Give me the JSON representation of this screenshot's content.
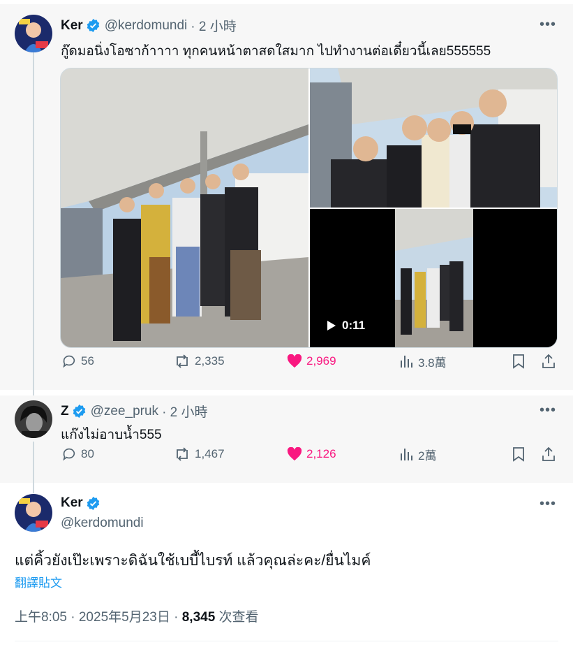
{
  "tweet1": {
    "name": "Ker",
    "handle": "@kerdomundi",
    "time": "· 2 小時",
    "text": "กู๊ดมอนิ่งโอซาก้าาาา ทุกคนหน้าตาสดใสมาก ไปทำงานต่อเดี๋ยวนี้เลย555555",
    "video_duration": "0:11",
    "replies": "56",
    "retweets": "2,335",
    "likes": "2,969",
    "views": "3.8萬"
  },
  "tweet2": {
    "name": "Z",
    "handle": "@zee_pruk",
    "time": "· 2 小時",
    "text": "แก๊งไม่อาบน้ำ555",
    "replies": "80",
    "retweets": "1,467",
    "likes": "2,126",
    "views": "2萬"
  },
  "tweet3": {
    "name": "Ker",
    "handle": "@kerdomundi",
    "text": "แต่คิ้วยังเป๊ะเพราะดิฉันใช้เบบี้ไบรท์ แล้วคุณล่ะคะ/ยื่นไมค์",
    "translate": "翻譯貼文",
    "timestamp": "上午8:05 · 2025年5月23日 · ",
    "views": "8,345",
    "views_suffix": " 次查看"
  },
  "more_label": "•••",
  "colors": {
    "accent": "#1d9bf0",
    "like": "#f91880",
    "muted": "#536471"
  }
}
